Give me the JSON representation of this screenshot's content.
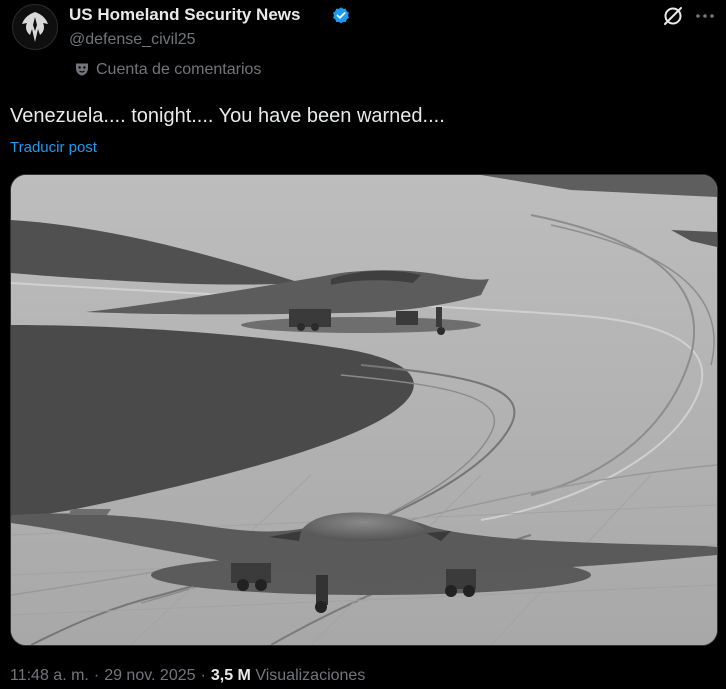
{
  "post": {
    "author": {
      "display_name": "US Homeland Security News",
      "handle": "@defense_civil25",
      "verified": true,
      "account_label": "Cuenta de comentarios"
    },
    "text": "Venezuela.... tonight.... You have been warned....",
    "translate_label": "Traducir post",
    "timestamp": "11:48 a. m.",
    "separator": "·",
    "date": "29 nov. 2025",
    "views_count": "3,5 M",
    "views_label": "Visualizaciones"
  },
  "icons": {
    "avatar": "shield-eagle-logo",
    "verified": "verified-badge-icon",
    "grok": "grok-icon",
    "more": "more-icon",
    "account_type": "mask-icon"
  },
  "colors": {
    "background": "#000000",
    "text_primary": "#e7e9ea",
    "text_secondary": "#71767b",
    "link": "#1d9bf0",
    "verified": "#1d9bf0"
  }
}
